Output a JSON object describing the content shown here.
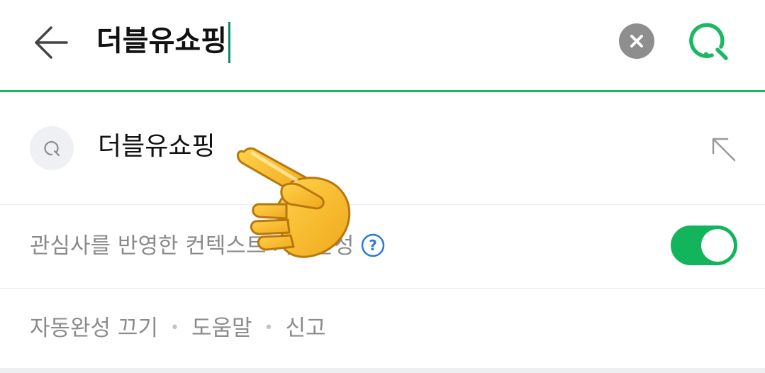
{
  "search": {
    "query": "더블유쇼핑",
    "clear_icon": "close-icon",
    "submit_icon": "search-icon",
    "back_icon": "arrow-left-icon"
  },
  "suggestion": {
    "text": "더블유쇼핑",
    "leading_icon": "search-icon",
    "trailing_icon": "arrow-up-left-icon"
  },
  "preference": {
    "label": "관심사를 반영한 컨텍스트 자동완성",
    "help_icon": "help-circle-icon",
    "toggle_on": true
  },
  "footer": {
    "links": [
      "자동완성 끄기",
      "도움말",
      "신고"
    ],
    "separator": "•"
  },
  "overlay": {
    "icon": "pointing-hand-icon"
  },
  "colors": {
    "accent": "#1cb963",
    "toggle_on": "#12b45c",
    "caret": "#0b8b6e",
    "muted_text": "#8b8b8b",
    "help_blue": "#2a7bd5"
  }
}
